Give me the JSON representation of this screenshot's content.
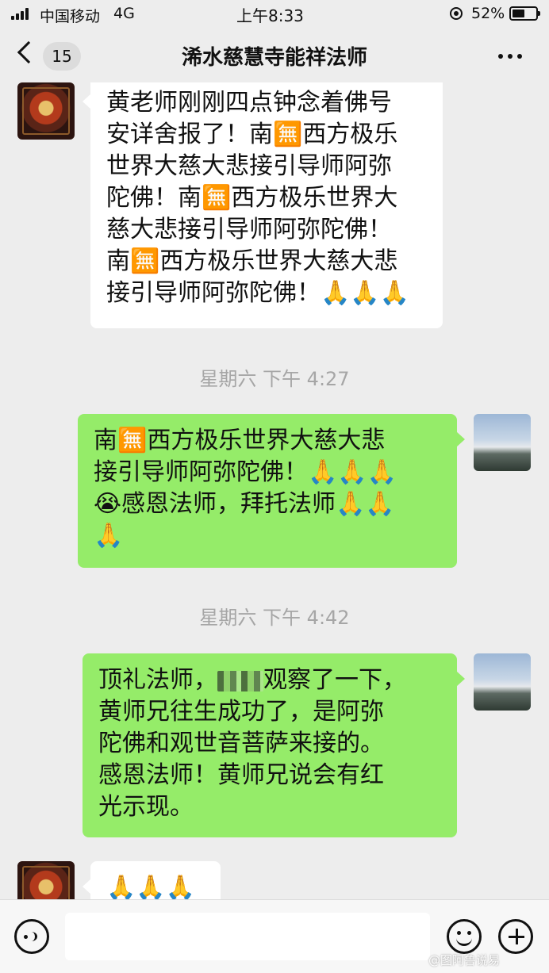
{
  "status_bar": {
    "carrier": "中国移动",
    "network": "4G",
    "time": "上午8:33",
    "battery": "52%"
  },
  "nav": {
    "unread_count": "15",
    "title": "浠水慈慧寺能祥法师"
  },
  "messages": [
    {
      "side": "received",
      "lines": [
        "黄老师刚刚四点钟念着佛号",
        "安详舍报了！南🈚西方极乐",
        "世界大慈大悲接引导师阿弥",
        "陀佛！南🈚西方极乐世界大",
        "慈大悲接引导师阿弥陀佛！",
        "南🈚西方极乐世界大慈大悲",
        "接引导师阿弥陀佛！🙏🙏🙏"
      ]
    },
    {
      "divider": "星期六 下午 4:27"
    },
    {
      "side": "sent",
      "lines": [
        "南🈚西方极乐世界大慈大悲",
        "接引导师阿弥陀佛！🙏🙏🙏",
        "😭感恩法师，拜托法师🙏🙏",
        "🙏"
      ]
    },
    {
      "divider": "星期六 下午 4:42"
    },
    {
      "side": "sent",
      "lines": [
        "顶礼法师，",
        "观察了一下，",
        "黄师兄往生成功了，是阿弥",
        "陀佛和观世音菩萨来接的。",
        "感恩法师！黄师兄说会有红",
        "光示现。"
      ]
    },
    {
      "side": "received",
      "lines": [
        "🙏🙏🙏"
      ]
    }
  ],
  "input": {
    "placeholder": ""
  },
  "watermark": "@图阿鲁说易",
  "colors": {
    "sent_bubble": "#95ec69",
    "received_bubble": "#ffffff",
    "background": "#ededed"
  }
}
